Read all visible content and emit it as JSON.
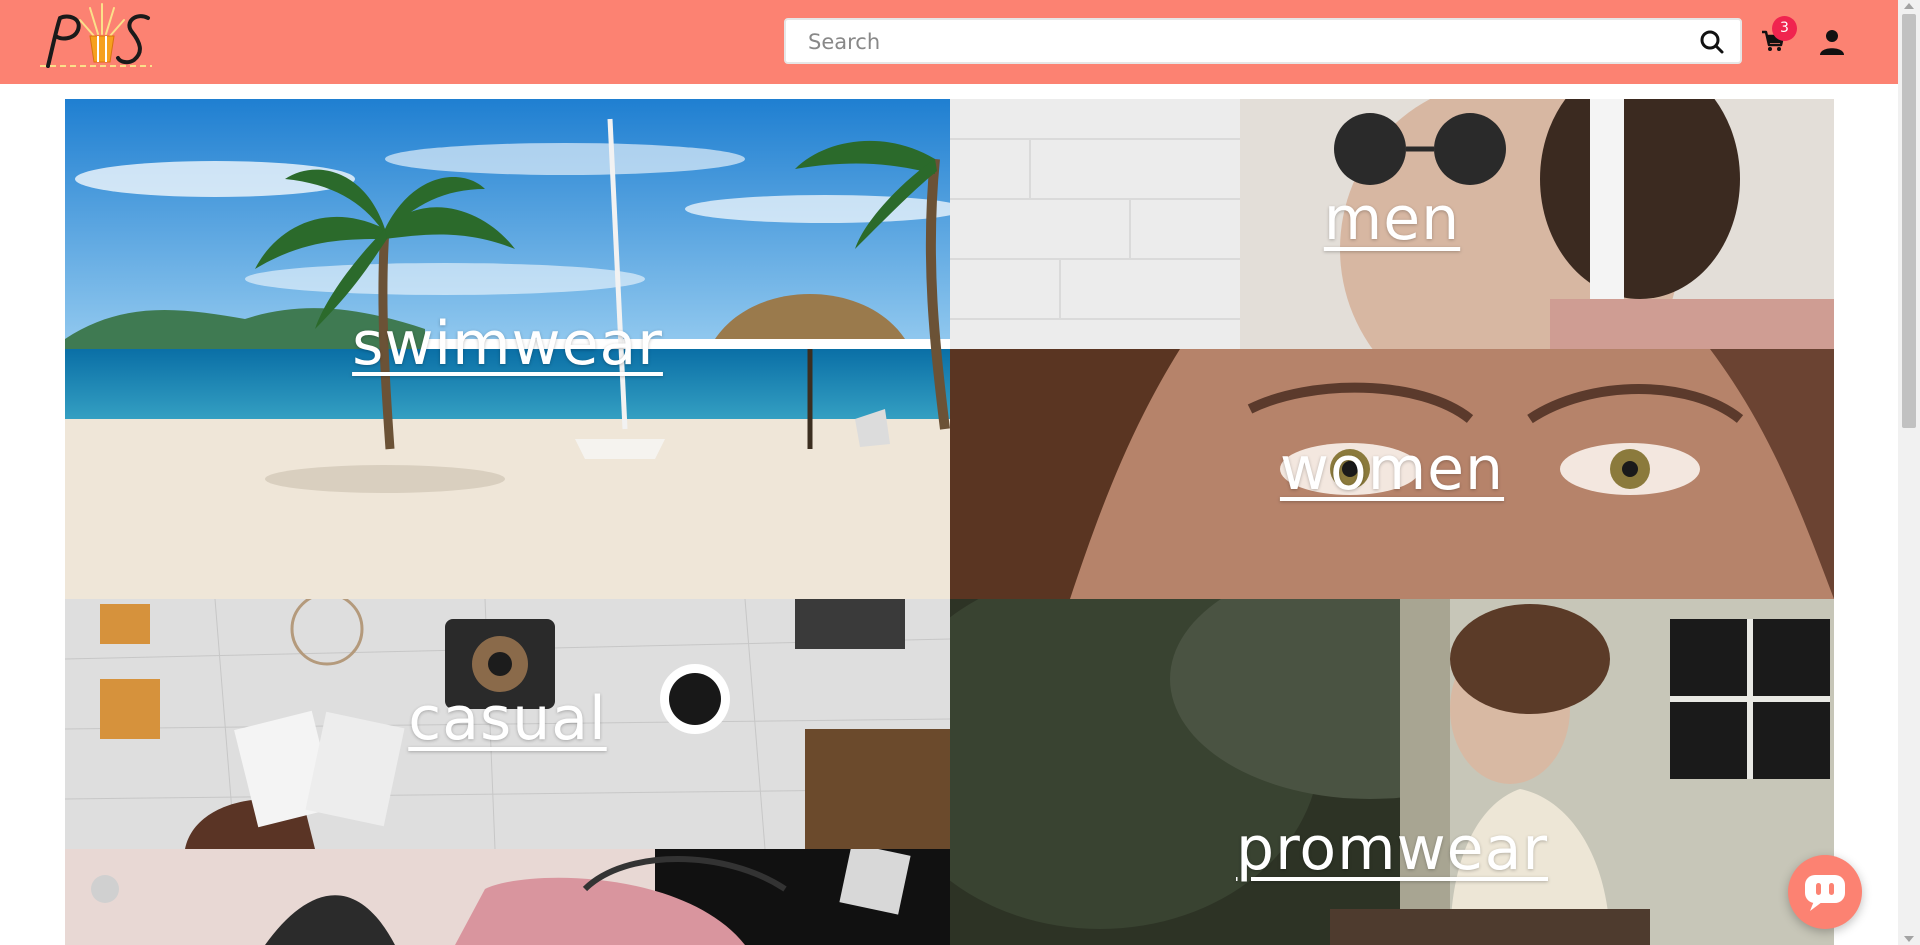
{
  "brand": {
    "logo_alt": "PS"
  },
  "colors": {
    "header": "#fc8272",
    "badge": "#f0244f",
    "text_on_image": "#ffffff"
  },
  "search": {
    "placeholder": "Search",
    "value": "",
    "icon": "search-icon"
  },
  "cart": {
    "icon": "cart-icon",
    "count": "3"
  },
  "account": {
    "icon": "user-icon"
  },
  "categories": [
    {
      "label": "swimwear",
      "image": "beach-with-palm-trees-and-umbrella"
    },
    {
      "label": "men",
      "image": "man-wearing-round-sunglasses"
    },
    {
      "label": "women",
      "image": "close-up-of-woman-eyes"
    },
    {
      "label": "casual",
      "image": "flat-lay-camera-coffee-map"
    },
    {
      "label": "promwear",
      "image": "woman-in-lace-dress-on-porch"
    },
    {
      "label": "",
      "image": "pink-handbag-and-glasses"
    }
  ],
  "chat": {
    "icon": "chat-bubble-icon"
  }
}
